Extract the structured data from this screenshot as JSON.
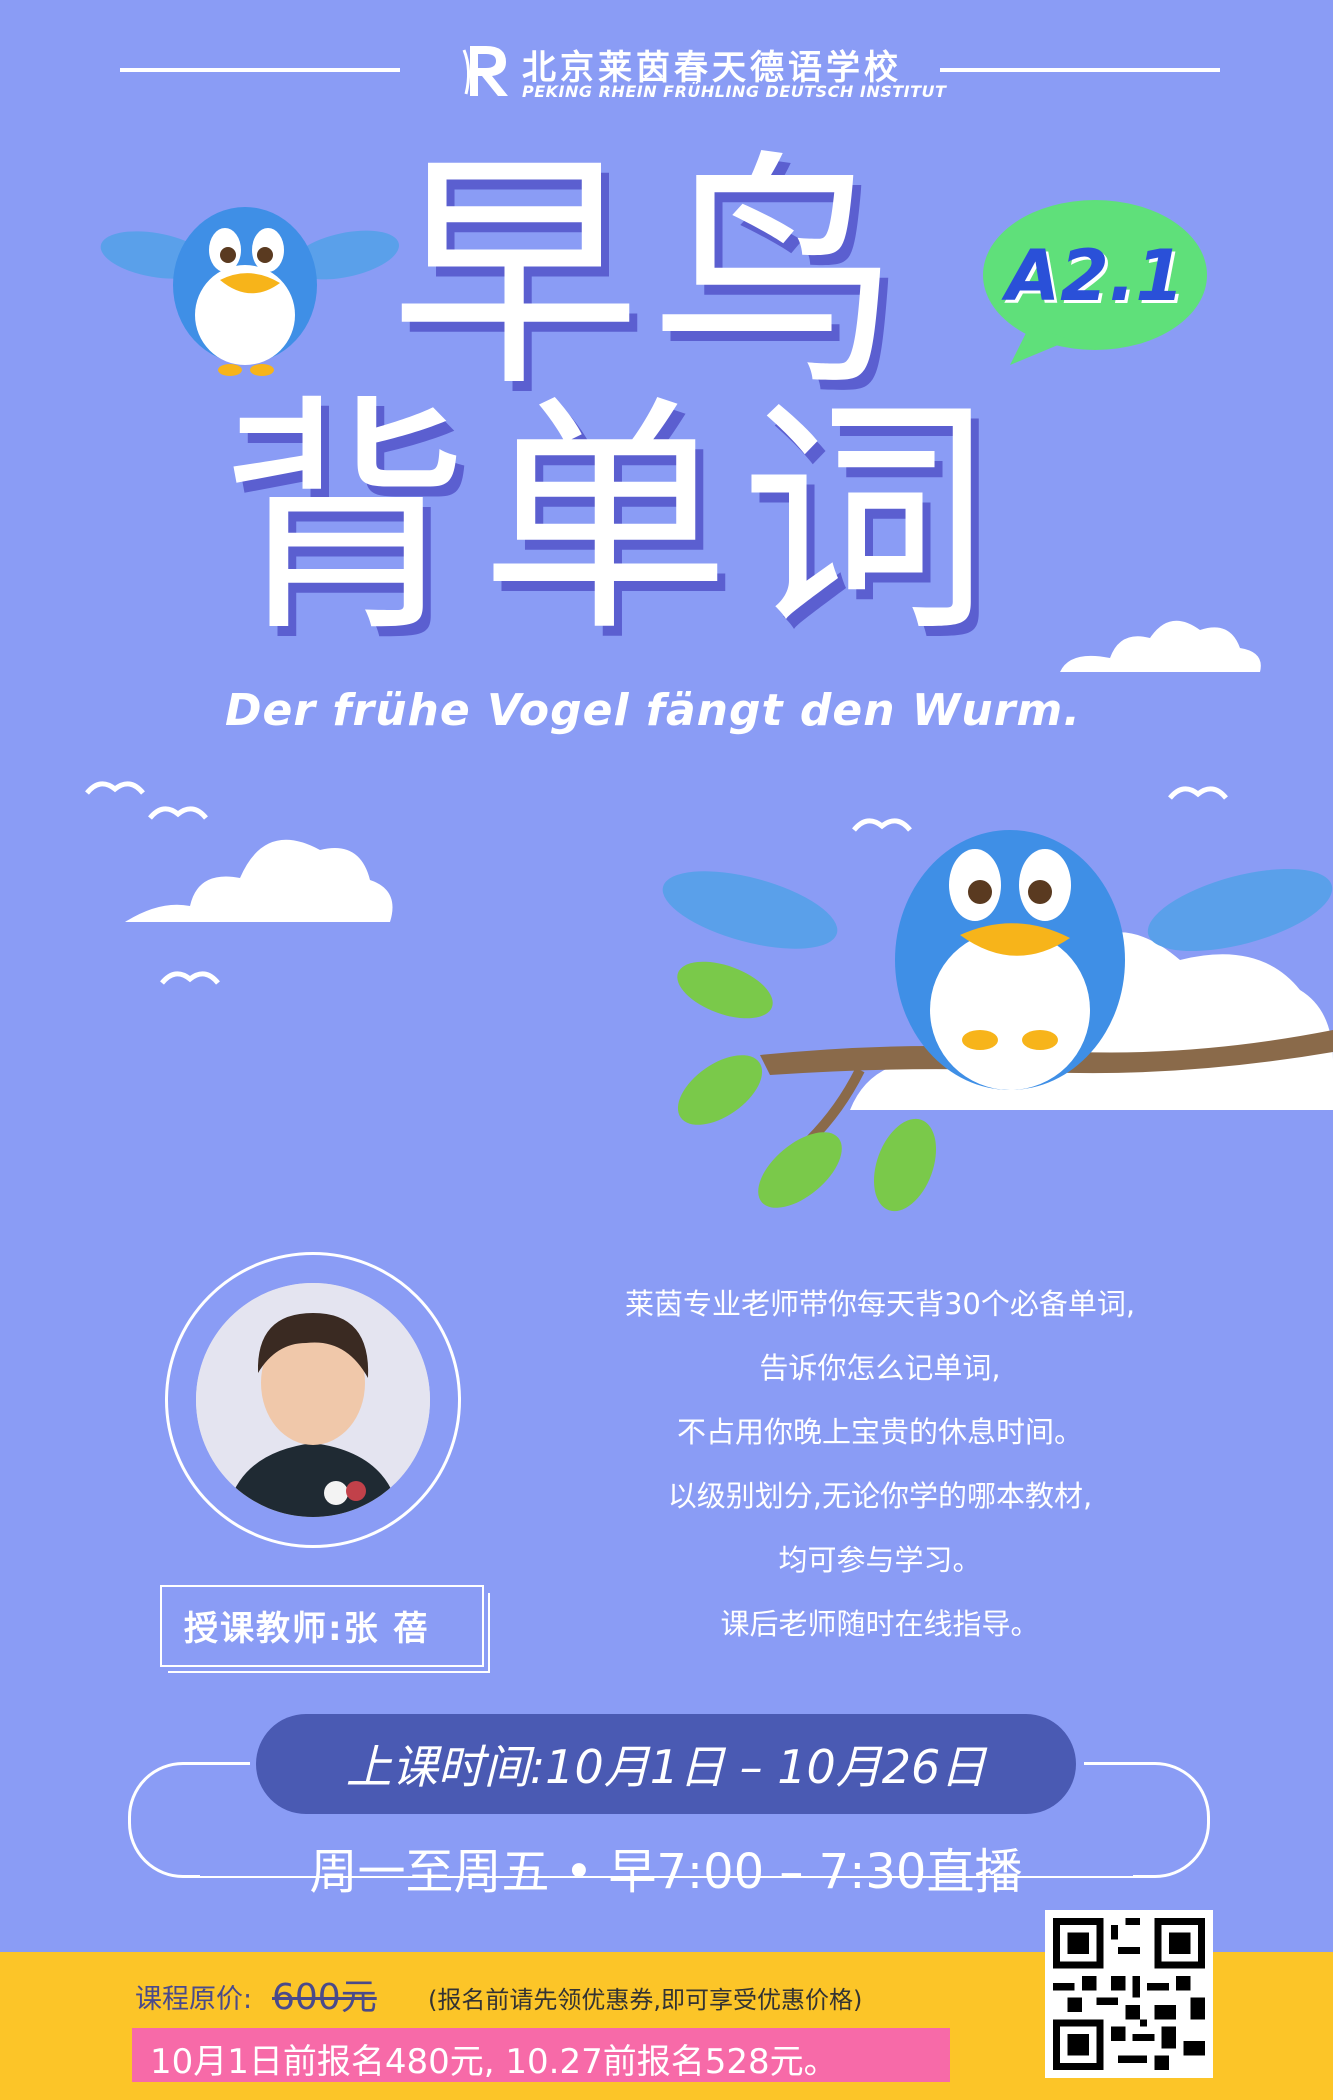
{
  "header": {
    "school_cn": "北京莱茵春天德语学校",
    "school_en": "PEKING RHEIN FRÜHLING DEUTSCH INSTITUT"
  },
  "title": {
    "line1": "早鸟",
    "line2": "背单词",
    "badge": "A2.1",
    "subtitle": "Der frühe Vogel fängt den Wurm."
  },
  "teacher": {
    "tag": "授课教师:张 蓓"
  },
  "description": [
    "莱茵专业老师带你每天背30个必备单词,",
    "告诉你怎么记单词,",
    "不占用你晚上宝贵的休息时间。",
    "以级别划分,无论你学的哪本教材,",
    "均可参与学习。",
    "课后老师随时在线指导。"
  ],
  "schedule": {
    "dates": "上课时间:10月1日 – 10月26日",
    "times": "周一至周五 • 早7:00 – 7:30直播"
  },
  "pricing": {
    "label": "课程原价:",
    "original": "600元",
    "note": "(报名前请先领优惠券,即可享受优惠价格)",
    "offer": "10月1日前报名480元, 10.27前报名528元。"
  },
  "colors": {
    "background": "#8a9cf5",
    "badge": "#5fe07a",
    "pill": "#4a5ab3",
    "footer": "#fcc528",
    "offer_bar": "#f76aa8"
  }
}
